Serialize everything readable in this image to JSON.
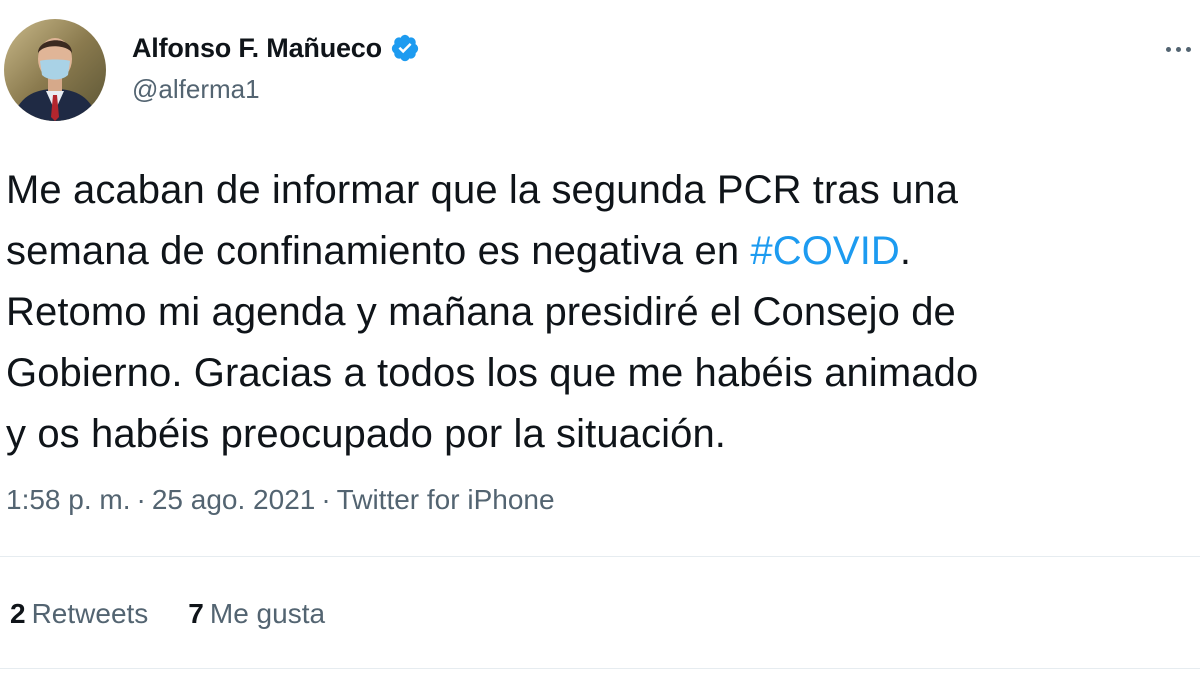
{
  "author": {
    "display_name": "Alfonso F. Mañueco",
    "handle": "@alferma1",
    "verified": true
  },
  "tweet": {
    "lines": [
      [
        "Me acaban de informar que la segunda PCR tras una"
      ],
      [
        "semana de confinamiento es negativa en ",
        "#COVID",
        "."
      ],
      [
        "Retomo mi agenda y mañana presidiré el Consejo de"
      ],
      [
        "Gobierno. Gracias a todos los que me habéis animado"
      ],
      [
        "y os habéis preocupado por la situación."
      ]
    ],
    "line1": "Me acaban de informar que la segunda PCR tras una",
    "line2_before": "semana de confinamiento es negativa en ",
    "hashtag": "#COVID",
    "line2_after": ".",
    "line3": "Retomo mi agenda y mañana presidiré el Consejo de",
    "line4": "Gobierno. Gracias a todos los que me habéis animado",
    "line5": "y os habéis preocupado por la situación."
  },
  "meta": {
    "time": "1:58 p. m.",
    "separator": "·",
    "date": "25 ago. 2021",
    "source": "Twitter for iPhone"
  },
  "stats": {
    "retweets_count": "2",
    "retweets_label": "Retweets",
    "likes_count": "7",
    "likes_label": "Me gusta"
  },
  "colors": {
    "hashtag": "#1d9bf0",
    "verified_badge": "#1d9bf0",
    "secondary_text": "#536471",
    "primary_text": "#0f1419"
  },
  "icons": {
    "verified": "verified-badge-icon",
    "more": "more-options-icon"
  }
}
